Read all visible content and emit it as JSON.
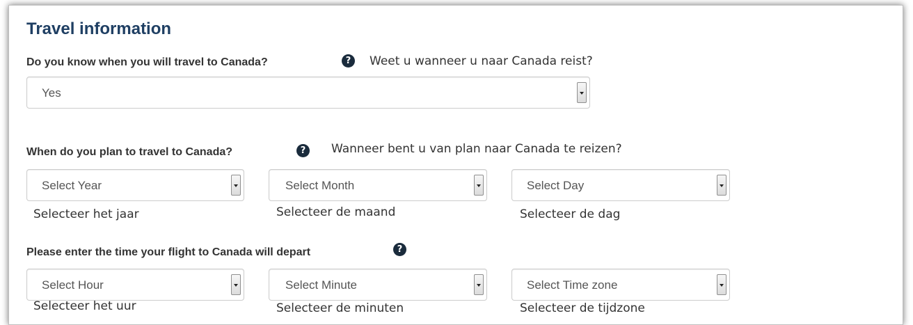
{
  "section": {
    "title": "Travel information"
  },
  "q_know": {
    "label": "Do you know when you will travel to Canada?",
    "translation": "Weet u wanneer u naar Canada reist?",
    "help_icon": "question-circle-icon",
    "value": "Yes"
  },
  "q_when": {
    "label": "When do you plan to travel to Canada?",
    "translation": "Wanneer bent u van plan naar Canada te reizen?",
    "help_icon": "question-circle-icon",
    "year": {
      "value": "Select Year",
      "translation": "Selecteer het jaar"
    },
    "month": {
      "value": "Select Month",
      "translation": "Selecteer de maand"
    },
    "day": {
      "value": "Select Day",
      "translation": "Selecteer de dag"
    }
  },
  "q_time": {
    "label": "Please enter the time your flight to Canada will depart",
    "help_icon": "question-circle-icon",
    "hour": {
      "value": "Select Hour",
      "translation": "Selecteer het uur"
    },
    "minute": {
      "value": "Select Minute",
      "translation": "Selecteer de minuten"
    },
    "timezone": {
      "value": "Select Time zone",
      "translation": "Selecteer de tijdzone"
    }
  },
  "colors": {
    "heading": "#1f3f63",
    "help_icon_bg": "#1a2b3c",
    "border": "#cccccc"
  }
}
